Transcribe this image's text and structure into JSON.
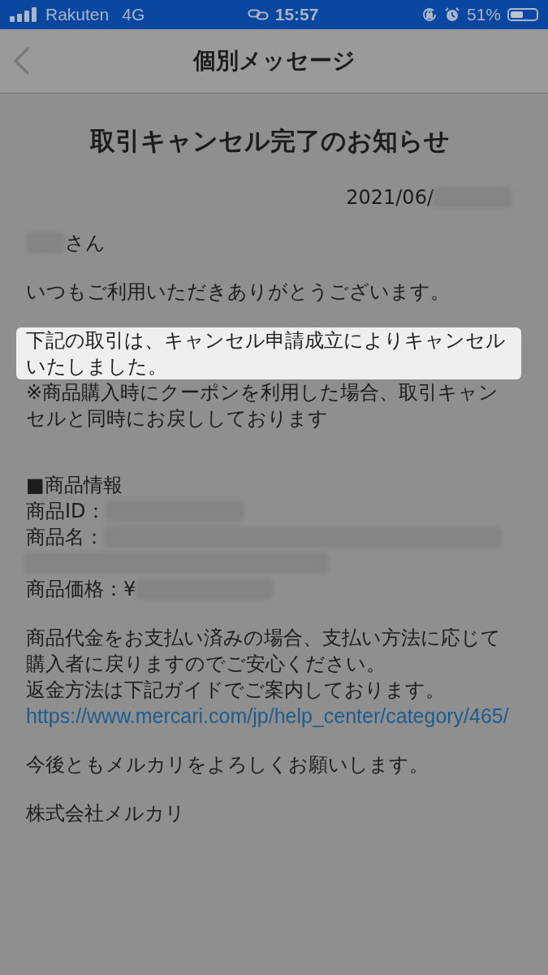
{
  "status_bar": {
    "carrier": "Rakuten",
    "network": "4G",
    "time": "15:57",
    "battery": "51%"
  },
  "header": {
    "title": "個別メッセージ"
  },
  "message": {
    "title": "取引キャンセル完了のお知らせ",
    "blocks": [
      {
        "kind": "date",
        "text": "2021/06/"
      },
      {
        "kind": "greeting",
        "text": "さん"
      },
      {
        "kind": "para",
        "lines": [
          {
            "text": "いつもご利用いただきありがとうございます。",
            "highlighted": false
          }
        ]
      },
      {
        "kind": "para",
        "lines": [
          {
            "text": "下記の取引は、キャンセル申請成立によりキャンセルいたしました。",
            "highlighted": true
          },
          {
            "text": "※商品購入時にクーポンを利用した場合、取引キャンセルと同時にお戻ししております",
            "highlighted": false
          }
        ]
      },
      {
        "kind": "heading",
        "text": "■商品情報"
      },
      {
        "kind": "field",
        "label": "商品ID："
      },
      {
        "kind": "field_long",
        "label": "商品名："
      },
      {
        "kind": "field",
        "label": "商品価格：¥"
      },
      {
        "kind": "para",
        "lines": [
          {
            "text": "商品代金をお支払い済みの場合、支払い方法に応じて購入者に戻りますのでご安心ください。",
            "highlighted": false
          },
          {
            "text": "返金方法は下記ガイドでご案内しております。",
            "highlighted": false
          }
        ]
      },
      {
        "kind": "link",
        "text": "https://www.mercari.com/jp/help_center/category/465/"
      },
      {
        "kind": "para",
        "lines": [
          {
            "text": "今後ともメルカリをよろしくお願いします。",
            "highlighted": false
          }
        ]
      },
      {
        "kind": "para",
        "lines": [
          {
            "text": "株式会社メルカリ",
            "highlighted": false
          }
        ]
      }
    ]
  }
}
